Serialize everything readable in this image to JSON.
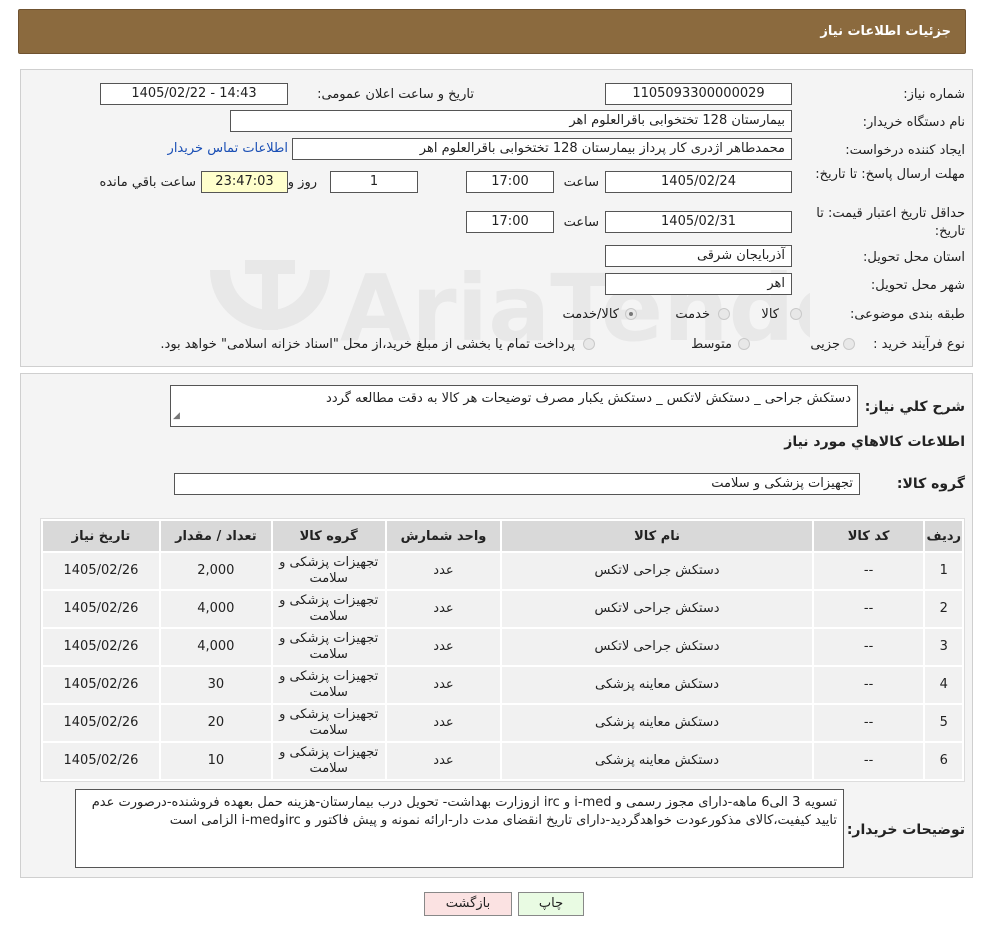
{
  "header": {
    "title": "جزئیات اطلاعات نیاز"
  },
  "fields": {
    "need_number_label": "شماره نیاز:",
    "need_number": "1105093300000029",
    "announce_label": "تاریخ و ساعت اعلان عمومی:",
    "announce_value": "1405/02/22 - 14:43",
    "buyer_org_label": "نام دستگاه خریدار:",
    "buyer_org": "بیمارستان 128 تختخوابی باقرالعلوم اهر",
    "requester_label": "ایجاد کننده درخواست:",
    "requester": "محمدطاهر اژدری کار پرداز بیمارستان 128 تختخوابی باقرالعلوم اهر",
    "contact_link": "اطلاعات تماس خریدار",
    "deadline_label": "مهلت ارسال پاسخ: تا تاریخ:",
    "deadline_date": "1405/02/24",
    "time_label": "ساعت",
    "deadline_time": "17:00",
    "days_value": "1",
    "days_label": "روز و",
    "remaining_value": "23:47:03",
    "remaining_label": "ساعت باقي مانده",
    "validity_label": "حداقل تاریخ اعتبار قیمت: تا تاریخ:",
    "validity_date": "1405/02/31",
    "validity_time": "17:00",
    "province_label": "استان محل تحویل:",
    "province": "آذربایجان شرقی",
    "city_label": "شهر محل تحویل:",
    "city": "اهر",
    "category_label": "طبقه بندی موضوعی:",
    "category_options": [
      "کالا",
      "خدمت",
      "کالا/خدمت"
    ],
    "process_label": "نوع فرآیند خرید :",
    "process_options": [
      "جزیی",
      "متوسط"
    ],
    "process_note": "پرداخت تمام یا بخشی از مبلغ خرید،از محل \"اسناد خزانه اسلامی\" خواهد بود."
  },
  "description": {
    "label": "شرح کلي نياز:",
    "value": "دستکش جراحی _ دستکش لاتکس _ دستکش یکبار مصرف توضیحات هر کالا به دقت مطالعه گردد"
  },
  "goods_title": "اطلاعات کالاهاي مورد نياز",
  "goods_group": {
    "label": "گروه کالا:",
    "value": "تجهیزات پزشکی و سلامت"
  },
  "table": {
    "headers": [
      "رديف",
      "کد کالا",
      "نام کالا",
      "واحد شمارش",
      "گروه کالا",
      "تعداد / مقدار",
      "تاریخ نیاز"
    ],
    "rows": [
      [
        "1",
        "--",
        "دستکش جراحی لاتکس",
        "عدد",
        "تجهیزات پزشکی و سلامت",
        "2,000",
        "1405/02/26"
      ],
      [
        "2",
        "--",
        "دستکش جراحی لاتکس",
        "عدد",
        "تجهیزات پزشکی و سلامت",
        "4,000",
        "1405/02/26"
      ],
      [
        "3",
        "--",
        "دستکش جراحی لاتکس",
        "عدد",
        "تجهیزات پزشکی و سلامت",
        "4,000",
        "1405/02/26"
      ],
      [
        "4",
        "--",
        "دستکش معاینه پزشکی",
        "عدد",
        "تجهیزات پزشکی و سلامت",
        "30",
        "1405/02/26"
      ],
      [
        "5",
        "--",
        "دستکش معاینه پزشکی",
        "عدد",
        "تجهیزات پزشکی و سلامت",
        "20",
        "1405/02/26"
      ],
      [
        "6",
        "--",
        "دستکش معاینه پزشکی",
        "عدد",
        "تجهیزات پزشکی و سلامت",
        "10",
        "1405/02/26"
      ]
    ]
  },
  "buyer_notes": {
    "label": "توضیحات خریدار:",
    "value": "تسویه 3 الی6 ماهه-دارای مجوز رسمی و i-med و irc ازوزارت بهداشت- تحویل درب بیمارستان-هزینه حمل بعهده فروشنده-درصورت عدم تایید کیفیت،کالای مذکورعودت خواهدگردید-دارای تاریخ انقضای مدت دار-ارائه نمونه و پیش فاکتور و irc‌وi-med الزامی است"
  },
  "buttons": {
    "back": "بازگشت",
    "print": "چاپ"
  },
  "watermark_text": "AriaTender.neT"
}
